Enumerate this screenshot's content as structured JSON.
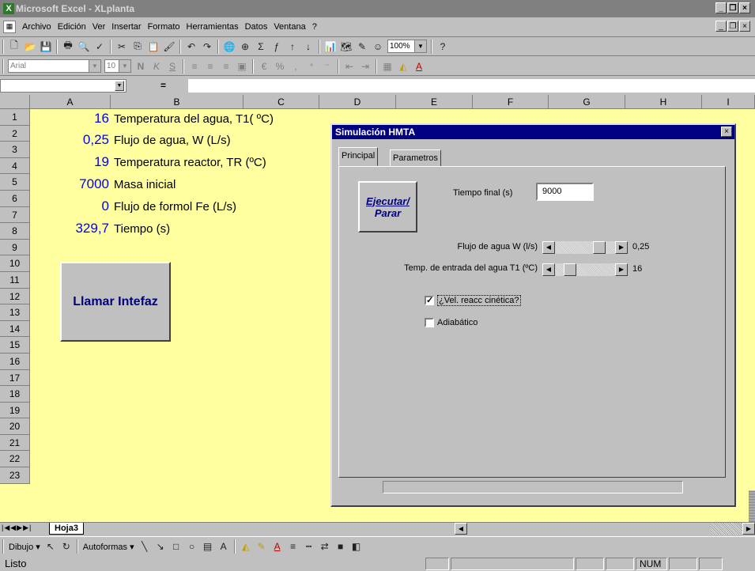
{
  "window": {
    "title": "Microsoft Excel - XLplanta",
    "app_icon": "excel-icon"
  },
  "menubar": {
    "items": [
      "Archivo",
      "Edición",
      "Ver",
      "Insertar",
      "Formato",
      "Herramientas",
      "Datos",
      "Ventana",
      "?"
    ]
  },
  "standard_toolbar": {
    "zoom": "100%"
  },
  "format_toolbar": {
    "font": "Arial",
    "size": "10"
  },
  "formula_bar": {
    "equals": "="
  },
  "columns": [
    "A",
    "B",
    "C",
    "D",
    "E",
    "F",
    "G",
    "H",
    "I"
  ],
  "rows": [
    "1",
    "2",
    "3",
    "4",
    "5",
    "6",
    "7",
    "8",
    "9",
    "10",
    "11",
    "12",
    "13",
    "14",
    "15",
    "16",
    "17",
    "18",
    "19",
    "20",
    "21",
    "22",
    "23"
  ],
  "cells": [
    {
      "value": "16",
      "label": "Temperatura del agua, T1( ºC)"
    },
    {
      "value": "0,25",
      "label": "Flujo de agua, W (L/s)"
    },
    {
      "value": "19",
      "label": "Temperatura reactor, TR (ºC)"
    },
    {
      "value": "7000",
      "label": "Masa inicial"
    },
    {
      "value": "0",
      "label": "Flujo de formol Fe (L/s)"
    },
    {
      "value": "329,7",
      "label": "Tiempo (s)"
    }
  ],
  "sheet_button": {
    "label": "Llamar Intefaz"
  },
  "dialog": {
    "title": "Simulación HMTA",
    "close": "×",
    "tabs": [
      "Principal",
      "Parametros"
    ],
    "run_button": {
      "line1": "Ejecutar/",
      "line2": "Parar"
    },
    "final_time": {
      "label": "Tiempo final (s)",
      "value": "9000"
    },
    "flow": {
      "label": "Flujo de agua W (l/s)",
      "value": "0,25",
      "slider_position": 0.8
    },
    "inlet_temp": {
      "label": "Temp. de entrada del agua T1 (ºC)",
      "value": "16",
      "slider_position": 0.18
    },
    "kinetic_check": {
      "label": "¿Vel. reacc cinética?",
      "checked": true
    },
    "adiabatic_check": {
      "label": "Adiabático",
      "checked": false
    }
  },
  "sheet_tabs": {
    "active": "Hoja3"
  },
  "drawing_toolbar": {
    "dibujo": "Dibujo",
    "autoformas": "Autoformas"
  },
  "statusbar": {
    "status": "Listo",
    "num": "NUM"
  }
}
